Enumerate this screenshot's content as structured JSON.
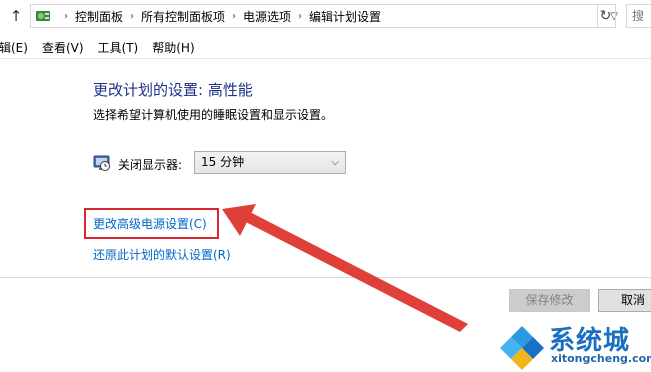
{
  "addressbar": {
    "breadcrumbs": [
      "控制面板",
      "所有控制面板项",
      "电源选项",
      "编辑计划设置"
    ],
    "search_placeholder": "搜"
  },
  "menu": {
    "items": [
      "辑(E)",
      "查看(V)",
      "工具(T)",
      "帮助(H)"
    ]
  },
  "main": {
    "title": "更改计划的设置: 高性能",
    "description": "选择希望计算机使用的睡眠设置和显示设置。",
    "display_off_label": "关闭显示器:",
    "display_off_value": "15 分钟",
    "advanced_link": "更改高级电源设置(C)",
    "restore_link": "还原此计划的默认设置(R)"
  },
  "footer": {
    "save_label": "保存修改",
    "cancel_label": "取消"
  },
  "annotation": {
    "highlight_color": "#d8272d",
    "arrow_color": "#e0403a"
  },
  "watermark": {
    "brand": "系统城",
    "url": "xitongcheng.com"
  },
  "colors": {
    "title": "#1e3287",
    "link": "#0066cc"
  }
}
